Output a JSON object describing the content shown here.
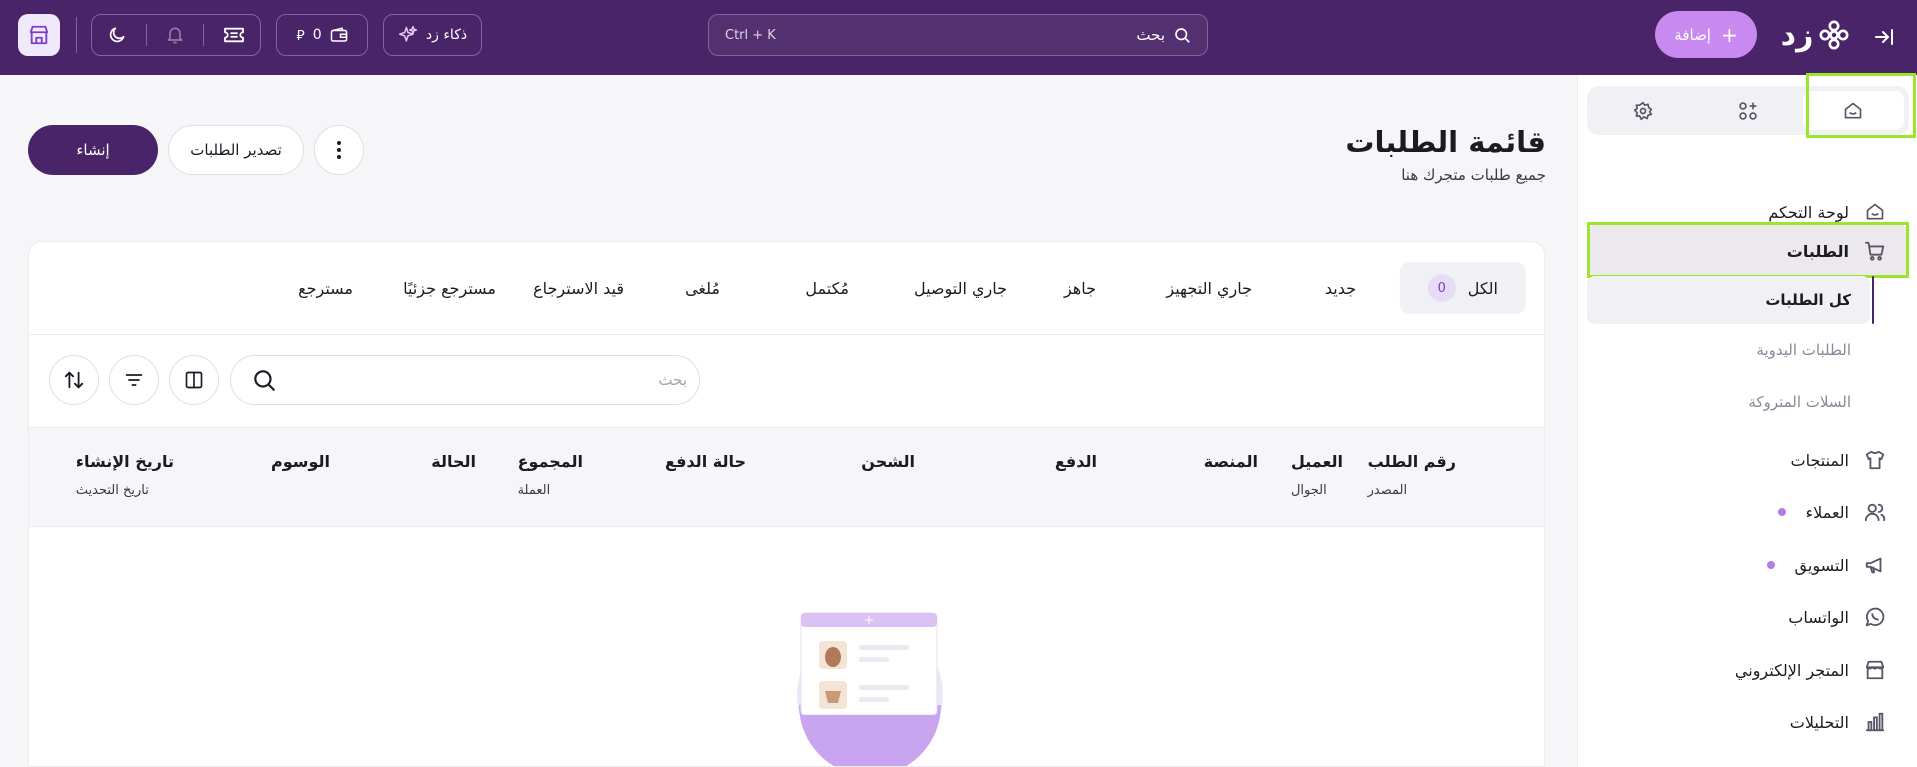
{
  "topbar": {
    "logo_text": "زد",
    "add_label": "إضافة",
    "search_label": "بحث",
    "search_shortcut": "Ctrl + K",
    "ai_label": "ذكاء زد",
    "wallet_value": "0",
    "currency_symbol": "⃁"
  },
  "sidebar": {
    "items": [
      {
        "label": "لوحة التحكم"
      },
      {
        "label": "الطلبات"
      },
      {
        "label": "المنتجات"
      },
      {
        "label": "العملاء"
      },
      {
        "label": "التسويق"
      },
      {
        "label": "الواتساب"
      },
      {
        "label": "المتجر الإلكتروني"
      },
      {
        "label": "التحليلات"
      }
    ],
    "orders_sub": [
      {
        "label": "كل الطلبات"
      },
      {
        "label": "الطلبات اليدوية"
      },
      {
        "label": "السلات المتروكة"
      }
    ]
  },
  "page": {
    "title": "قائمة الطلبات",
    "subtitle": "جميع طلبات متجرك هنا",
    "create_label": "إنشاء",
    "export_label": "تصدير الطلبات"
  },
  "status_tabs": [
    {
      "label": "الكل",
      "count": "0"
    },
    {
      "label": "جديد"
    },
    {
      "label": "جاري التجهيز"
    },
    {
      "label": "جاهز"
    },
    {
      "label": "جاري التوصيل"
    },
    {
      "label": "مُكتمل"
    },
    {
      "label": "مُلغى"
    },
    {
      "label": "قيد الاسترجاع"
    },
    {
      "label": "مسترجع جزئيًا"
    },
    {
      "label": "مسترجع"
    }
  ],
  "search": {
    "placeholder": "بحث"
  },
  "table": {
    "columns": [
      {
        "label": "رقم الطلب",
        "sub": "المصدر"
      },
      {
        "label": "العميل",
        "sub": "الجوال"
      },
      {
        "label": "المنصة",
        "sub": ""
      },
      {
        "label": "الدفع",
        "sub": ""
      },
      {
        "label": "الشحن",
        "sub": ""
      },
      {
        "label": "حالة الدفع",
        "sub": ""
      },
      {
        "label": "المجموع",
        "sub": "العملة"
      },
      {
        "label": "الحالة",
        "sub": ""
      },
      {
        "label": "الوسوم",
        "sub": ""
      },
      {
        "label": "تاريخ الإنشاء",
        "sub": "تاريخ التحديث"
      }
    ]
  },
  "colors": {
    "topbar": "#4a2468",
    "accent": "#c88af0",
    "primary": "#4a2468",
    "highlight": "#9ae62a",
    "badge_dot": "#b57bea"
  },
  "icons": {
    "collapse": "collapse-sidebar-icon",
    "logo": "zid-logo-icon",
    "search": "search-icon",
    "ai": "sparkle-icon",
    "wallet": "wallet-icon",
    "ticket": "ticket-icon",
    "bell": "bell-icon",
    "moon": "moon-icon",
    "store": "store-icon"
  }
}
